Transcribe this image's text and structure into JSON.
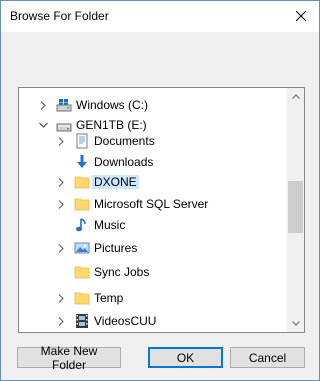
{
  "window": {
    "title": "Browse For Folder"
  },
  "tree": {
    "items": [
      {
        "label": "Windows (C:)",
        "icon": "drive-windows-icon",
        "expand": "collapsed",
        "level": 1
      },
      {
        "label": "GEN1TB (E:)",
        "icon": "drive-icon",
        "expand": "expanded",
        "level": 1
      },
      {
        "label": "Documents",
        "icon": "documents-folder-icon",
        "expand": "collapsed",
        "level": 2
      },
      {
        "label": "Downloads",
        "icon": "downloads-folder-icon",
        "expand": "none",
        "level": 2
      },
      {
        "label": "DXONE",
        "icon": "folder-icon",
        "expand": "collapsed",
        "level": 2,
        "selected": true
      },
      {
        "label": "Microsoft SQL Server",
        "icon": "folder-icon",
        "expand": "collapsed",
        "level": 2
      },
      {
        "label": "Music",
        "icon": "music-folder-icon",
        "expand": "none",
        "level": 2
      },
      {
        "label": "Pictures",
        "icon": "pictures-folder-icon",
        "expand": "collapsed",
        "level": 2
      },
      {
        "label": "Sync Jobs",
        "icon": "folder-icon",
        "expand": "none",
        "level": 2
      },
      {
        "label": "Temp",
        "icon": "folder-icon",
        "expand": "collapsed",
        "level": 2
      },
      {
        "label": "VideosCUU",
        "icon": "video-folder-icon",
        "expand": "collapsed",
        "level": 2
      }
    ]
  },
  "buttons": {
    "make_new_folder": "Make New Folder",
    "ok": "OK",
    "cancel": "Cancel"
  },
  "colors": {
    "selection": "#cce8ff",
    "folder": "#ffd96b",
    "accent": "#0078d7"
  }
}
